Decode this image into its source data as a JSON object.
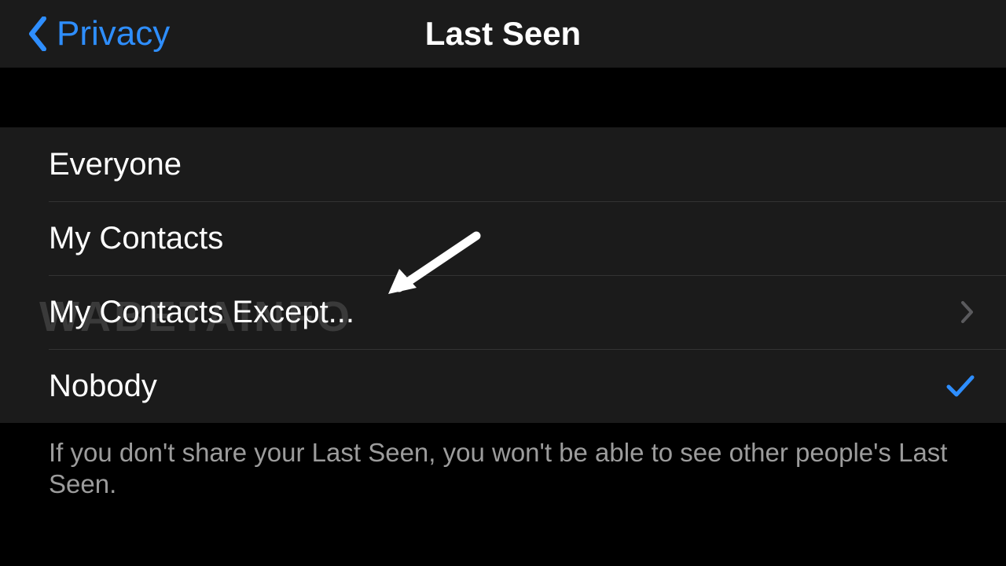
{
  "nav": {
    "back_label": "Privacy",
    "title": "Last Seen"
  },
  "options": {
    "everyone": "Everyone",
    "my_contacts": "My Contacts",
    "my_contacts_except": "My Contacts Except...",
    "nobody": "Nobody"
  },
  "selected": "nobody",
  "footer_text": "If you don't share your Last Seen, you won't be able to see other people's Last Seen.",
  "watermark": "WABETAINFO"
}
